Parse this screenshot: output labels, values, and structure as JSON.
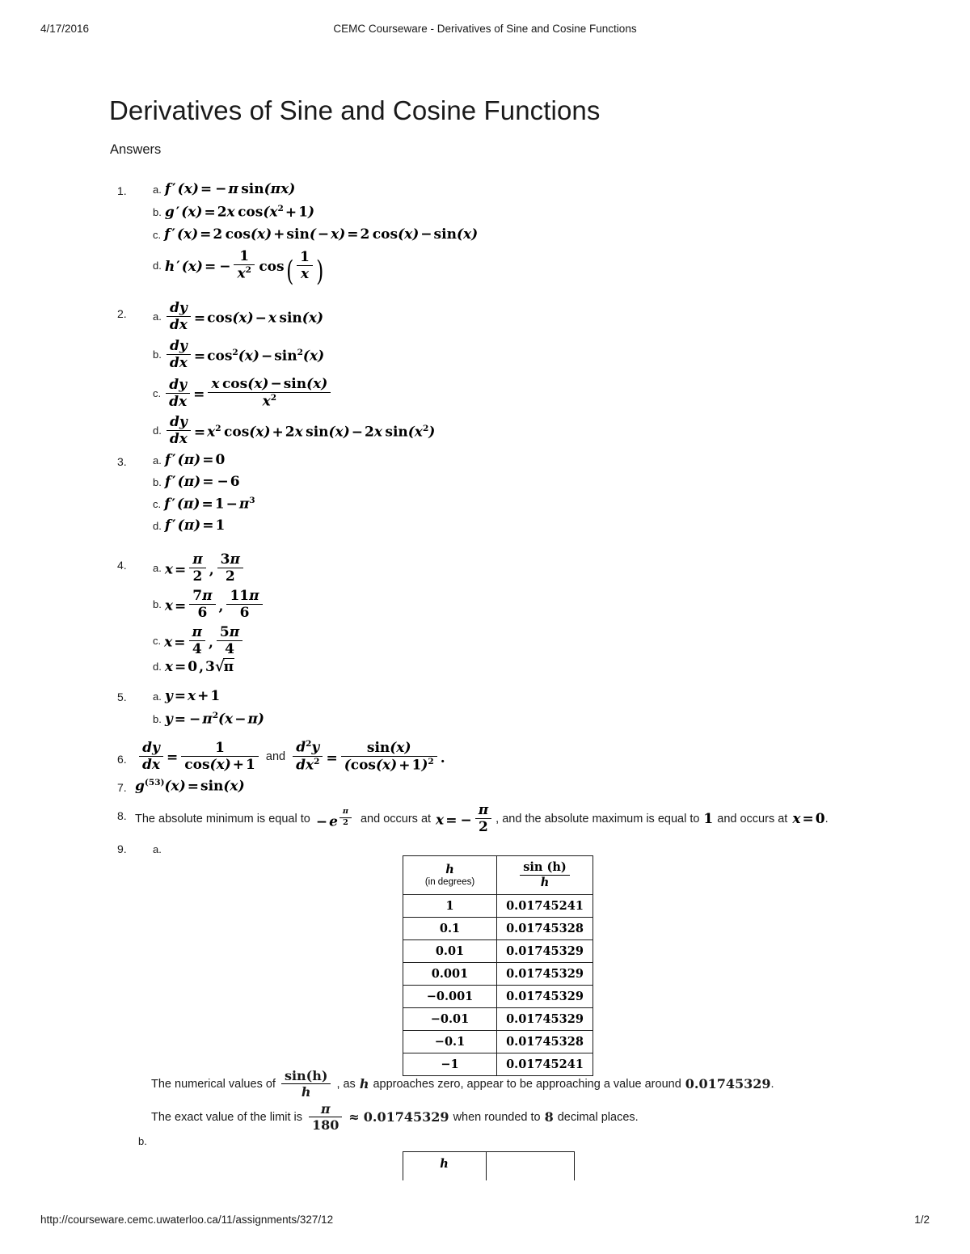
{
  "print_header": {
    "date": "4/17/2016",
    "title": "CEMC Courseware - Derivatives of Sine and Cosine Functions"
  },
  "print_footer": {
    "url": "http://courseware.cemc.uwaterloo.ca/11/assignments/327/12",
    "page": "1/2"
  },
  "document": {
    "title": "Derivatives of Sine and Cosine Functions",
    "subtitle": "Answers"
  },
  "answers": {
    "q1": {
      "number": "1.",
      "a": {
        "label": "a.",
        "text": "f'(x) = -π sin(πx)"
      },
      "b": {
        "label": "b.",
        "text": "g'(x) = 2x cos(x² + 1)"
      },
      "c": {
        "label": "c.",
        "text": "f'(x) = 2 cos(x) + sin(-x) = 2 cos(x) - sin(x)"
      },
      "d": {
        "label": "d.",
        "text": "h'(x) = -(1/x²) cos(1/x)"
      }
    },
    "q2": {
      "number": "2.",
      "a": {
        "label": "a.",
        "text": "dy/dx = cos(x) - x sin(x)"
      },
      "b": {
        "label": "b.",
        "text": "dy/dx = cos²(x) - sin²(x)"
      },
      "c": {
        "label": "c.",
        "text": "dy/dx = (x cos(x) - sin(x)) / x²"
      },
      "d": {
        "label": "d.",
        "text": "dy/dx = x² cos(x) + 2x sin(x) - 2x sin(x²)"
      }
    },
    "q3": {
      "number": "3.",
      "a": {
        "label": "a.",
        "text": "f'(π) = 0"
      },
      "b": {
        "label": "b.",
        "text": "f'(π) = -6"
      },
      "c": {
        "label": "c.",
        "text": "f'(π) = 1 - π³"
      },
      "d": {
        "label": "d.",
        "text": "f'(π) = 1"
      }
    },
    "q4": {
      "number": "4.",
      "a": {
        "label": "a.",
        "text": "x = π/2, 3π/2"
      },
      "b": {
        "label": "b.",
        "text": "x = 7π/6, 11π/6"
      },
      "c": {
        "label": "c.",
        "text": "x = π/4, 5π/4"
      },
      "d": {
        "label": "d.",
        "text": "x = 0, 3√π"
      }
    },
    "q5": {
      "number": "5.",
      "a": {
        "label": "a.",
        "text": "y = x + 1"
      },
      "b": {
        "label": "b.",
        "text": "y = -π²(x - π)"
      }
    },
    "q6": {
      "number": "6.",
      "text": "dy/dx = 1/(cos(x) + 1) and d²y/dx² = sin(x)/(cos(x) + 1)².",
      "conjunction": "and"
    },
    "q7": {
      "number": "7.",
      "text": "g^(53)(x) = sin(x)",
      "order": "(53)"
    },
    "q8": {
      "number": "8.",
      "part1": "The absolute minimum is equal to",
      "min_value": "-e^(π/2)",
      "part2": "and occurs at",
      "min_at": "x = -π/2",
      "part3": ", and the absolute maximum is equal to",
      "max_value": "1",
      "part4": "and occurs at",
      "max_at": "x = 0",
      "period": "."
    },
    "q9": {
      "number": "9.",
      "a_label": "a.",
      "b_label": "b.",
      "table_a": {
        "headers": {
          "h": "h",
          "h_sub": "(in degrees)",
          "ratio_num": "sin (h)",
          "ratio_den": "h"
        },
        "rows": [
          {
            "h": "1",
            "value": "0.01745241"
          },
          {
            "h": "0.1",
            "value": "0.01745328"
          },
          {
            "h": "0.01",
            "value": "0.01745329"
          },
          {
            "h": "0.001",
            "value": "0.01745329"
          },
          {
            "h": "−0.001",
            "value": "0.01745329"
          },
          {
            "h": "−0.01",
            "value": "0.01745329"
          },
          {
            "h": "−0.1",
            "value": "0.01745328"
          },
          {
            "h": "−1",
            "value": "0.01745241"
          }
        ]
      },
      "narrative1": {
        "p1": "The numerical values of",
        "frac_num": "sin(h)",
        "frac_den": "h",
        "p2": ", as",
        "var": "h",
        "p3": "approaches zero, appear to be approaching a value around",
        "approach_value": "0.01745329",
        "p4": "."
      },
      "narrative2": {
        "p1": "The exact value of the limit is",
        "frac_num": "π",
        "frac_den": "180",
        "approx": "≈",
        "value": "0.01745329",
        "p2": "when rounded to",
        "places": "8",
        "p3": "decimal places."
      },
      "table_b": {
        "headers": {
          "h": "h"
        }
      }
    }
  }
}
